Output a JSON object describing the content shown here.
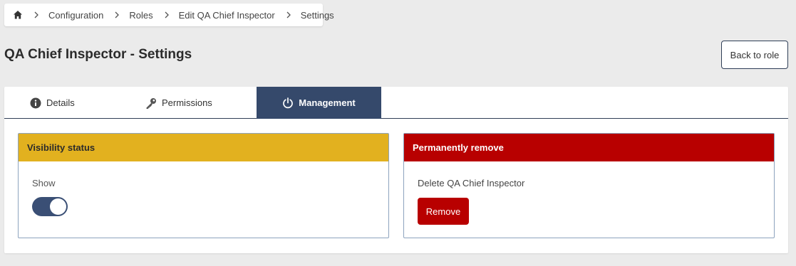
{
  "breadcrumb": {
    "home_icon": "home-icon",
    "items": [
      "Configuration",
      "Roles",
      "Edit QA Chief Inspector",
      "Settings"
    ]
  },
  "page": {
    "title": "QA Chief Inspector - Settings",
    "back_button": "Back to role"
  },
  "tabs": [
    {
      "label": "Details",
      "icon": "info-icon",
      "active": false
    },
    {
      "label": "Permissions",
      "icon": "key-icon",
      "active": false
    },
    {
      "label": "Management",
      "icon": "power-icon",
      "active": true
    }
  ],
  "visibility": {
    "header": "Visibility status",
    "label": "Show",
    "toggle_on": true
  },
  "remove": {
    "header": "Permanently remove",
    "label": "Delete QA Chief Inspector",
    "button": "Remove"
  },
  "colors": {
    "active_tab": "#35496b",
    "visibility_header": "#e2b11f",
    "remove_header": "#b80000",
    "toggle": "#3a4f75"
  }
}
